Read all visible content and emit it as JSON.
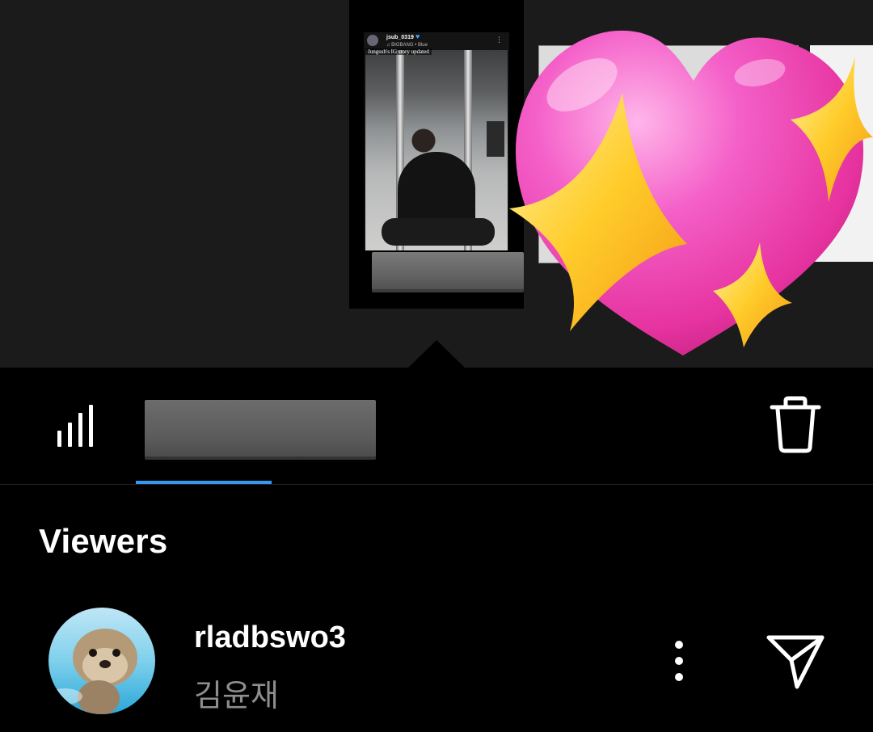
{
  "story_preview": {
    "embed_username": "jsub_0319",
    "embed_music": "♫ BIGBANG • Blue",
    "embed_caption": "Jungsub's IG story updated",
    "embed_menu": "⋮"
  },
  "tabs": {
    "active_tab": "stats"
  },
  "viewers": {
    "heading": "Viewers",
    "items": [
      {
        "username": "rladbswo3",
        "full_name": "김윤재"
      }
    ]
  },
  "colors": {
    "accent": "#3897f0",
    "background": "#000000",
    "strip_background": "#1b1b1b",
    "secondary_text": "#8e8e8e",
    "heart_pink": "#f04bb8",
    "sparkle_yellow": "#ffcc2a"
  },
  "icons": {
    "stats": "bar-chart-icon",
    "delete": "trash-icon",
    "more": "more-vertical-icon",
    "send": "paper-plane-icon",
    "sticker": "sparkling-heart-icon"
  }
}
